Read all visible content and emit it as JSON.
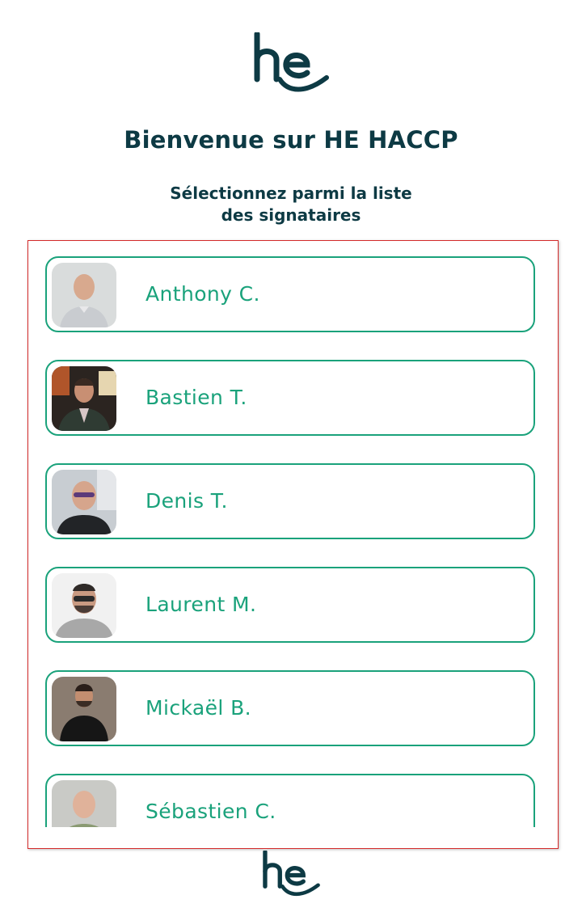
{
  "header": {
    "title": "Bienvenue sur HE HACCP",
    "subtitle_line1": "Sélectionnez parmi la liste",
    "subtitle_line2": "des signataires",
    "logo_text": "he"
  },
  "signatories": [
    {
      "name": "Anthony C.",
      "avatar": "photo-bald-man-light-shirt"
    },
    {
      "name": "Bastien T.",
      "avatar": "photo-man-dark-jacket"
    },
    {
      "name": "Denis T.",
      "avatar": "photo-bald-man-glasses"
    },
    {
      "name": "Laurent M.",
      "avatar": "photo-man-glasses-beard"
    },
    {
      "name": "Mickaël B.",
      "avatar": "photo-man-black-tshirt"
    },
    {
      "name": "Sébastien C.",
      "avatar": "photo-man-green-shirt"
    }
  ],
  "footer": {
    "logo_text": "he"
  },
  "colors": {
    "brand_dark": "#0d3a44",
    "accent_green": "#1aa27b",
    "frame_red": "#d42a2a"
  }
}
